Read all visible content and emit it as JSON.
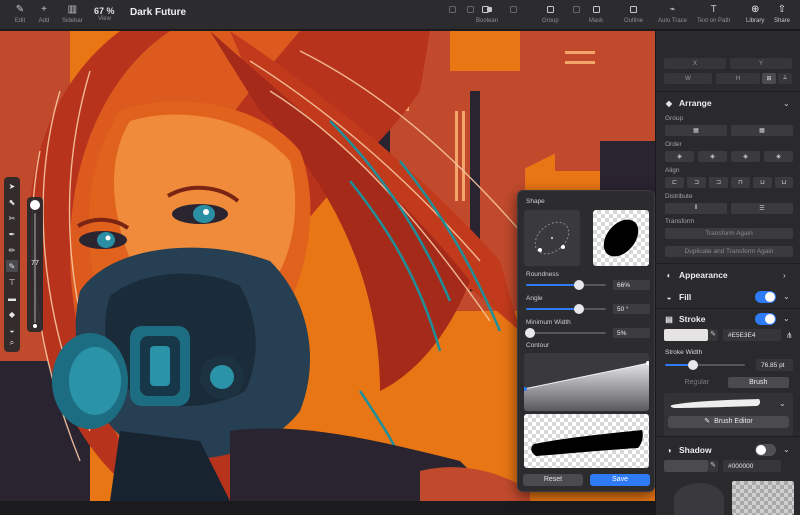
{
  "toolbar": {
    "items": [
      {
        "label": "Edit",
        "icon": "pencil-icon"
      },
      {
        "label": "Add",
        "icon": "plus-icon"
      },
      {
        "label": "Sidebar",
        "icon": "sidebar-icon"
      },
      {
        "label": "View",
        "icon": "view-icon"
      },
      {
        "label": "Boolean",
        "icon": "boolean-icon"
      },
      {
        "label": "Group",
        "icon": "group-icon"
      },
      {
        "label": "Mask",
        "icon": "mask-icon"
      },
      {
        "label": "Outline",
        "icon": "outline-icon"
      },
      {
        "label": "Auto Trace",
        "icon": "auto-trace-icon"
      },
      {
        "label": "Text on Path",
        "icon": "text-on-path-icon"
      },
      {
        "label": "Library",
        "icon": "library-icon"
      },
      {
        "label": "Share",
        "icon": "share-icon"
      }
    ],
    "zoom": "67 %",
    "title": "Dark Future"
  },
  "brush_size": "77",
  "popover": {
    "shape_label": "Shape",
    "roundness_label": "Roundness",
    "roundness_value": "66%",
    "roundness_fraction": 0.66,
    "angle_label": "Angle",
    "angle_value": "50 °",
    "angle_fraction": 0.66,
    "min_width_label": "Minimum Width",
    "min_width_value": "5%",
    "min_width_fraction": 0.05,
    "contour_label": "Contour",
    "reset_label": "Reset",
    "save_label": "Save"
  },
  "inspector": {
    "x_label": "X",
    "y_label": "Y",
    "w_label": "W",
    "h_label": "H",
    "arrange_title": "Arrange",
    "group_label": "Group",
    "order_label": "Order",
    "align_label": "Align",
    "distribute_label": "Distribute",
    "transform_label": "Transform",
    "transform_again": "Transform Again",
    "duplicate_transform": "Duplicate and Transform Again",
    "appearance_title": "Appearance",
    "fill_title": "Fill",
    "fill_enabled": true,
    "stroke_title": "Stroke",
    "stroke_enabled": true,
    "stroke_color": "#E5E3E4",
    "stroke_width_label": "Stroke Width",
    "stroke_width_value": "76.85 pt",
    "stroke_width_fraction": 0.35,
    "style_regular": "Regular",
    "style_brush": "Brush",
    "brush_editor": "Brush Editor",
    "shadow_title": "Shadow",
    "shadow_enabled": false,
    "shadow_color": "#000000"
  },
  "colors": {
    "accent": "#2f7bf5",
    "canvas_orange": "#e97614",
    "panel": "#2a2a2d"
  }
}
